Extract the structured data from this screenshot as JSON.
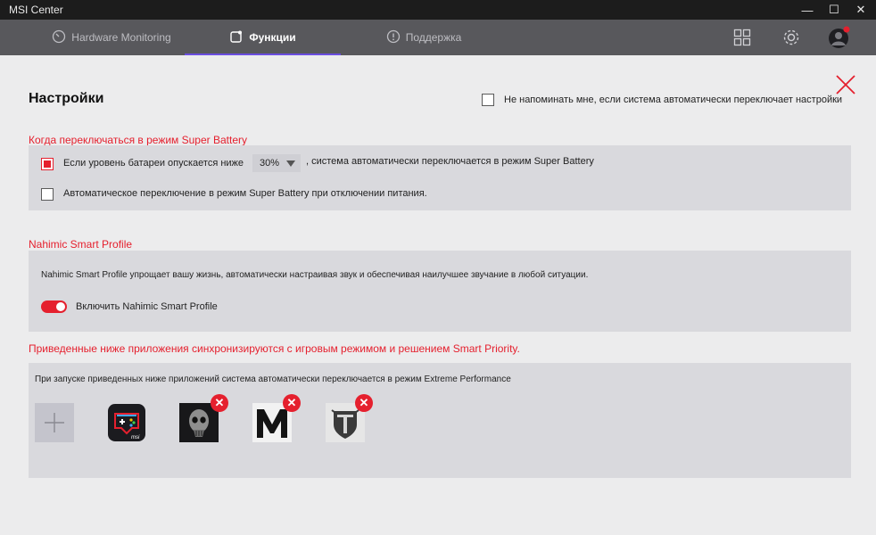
{
  "window": {
    "title": "MSI Center",
    "controls": {
      "minimize": "—",
      "maximize": "☐",
      "close": "✕"
    }
  },
  "nav": {
    "tabs": [
      {
        "label": "Hardware Monitoring",
        "icon": "gauge-icon",
        "active": false
      },
      {
        "label": "Функции",
        "icon": "features-icon",
        "active": true
      },
      {
        "label": "Поддержка",
        "icon": "support-icon",
        "active": false
      }
    ],
    "right_icons": [
      "grid-icon",
      "gear-icon",
      "avatar"
    ]
  },
  "colors": {
    "accent": "#e5202e",
    "nav_bg": "#58585c",
    "panel_bg": "#d9d9dd",
    "active_underline": "#6a4de0"
  },
  "page": {
    "title": "Настройки",
    "reminder": {
      "label": "Не напоминать мне, если система автоматически переключает настройки",
      "checked": false
    }
  },
  "super_battery": {
    "title": "Когда переключаться в режим Super Battery",
    "battery_option": {
      "checked": true,
      "prefix": "Если уровень батареи опускается ниже",
      "dropdown_value": "30%",
      "suffix": ", система автоматически переключается в режим Super Battery"
    },
    "unplug_option": {
      "checked": false,
      "label": "Автоматическое переключение в режим Super Battery при отключении питания."
    }
  },
  "nahimic": {
    "title": "Nahimic Smart Profile",
    "description": "Nahimic Smart Profile упрощает вашу жизнь, автоматически настраивая звук и обеспечивая наилучшее звучание в любой ситуации.",
    "toggle_label": "Включить Nahimic Smart Profile",
    "enabled": true
  },
  "apps_section": {
    "title": "Приведенные ниже приложения синхронизируются с игровым режимом и решением Smart Priority.",
    "description": "При запуске приведенных ниже приложений система автоматически переключается в режим Extreme Performance",
    "add_label": "+",
    "apps": [
      {
        "name": "msi-gamepad-app-icon",
        "removable": false
      },
      {
        "name": "skull-game-app-icon",
        "removable": true
      },
      {
        "name": "metro-m-app-icon",
        "removable": true
      },
      {
        "name": "world-of-tanks-app-icon",
        "removable": true
      }
    ],
    "remove_glyph": "✕"
  }
}
